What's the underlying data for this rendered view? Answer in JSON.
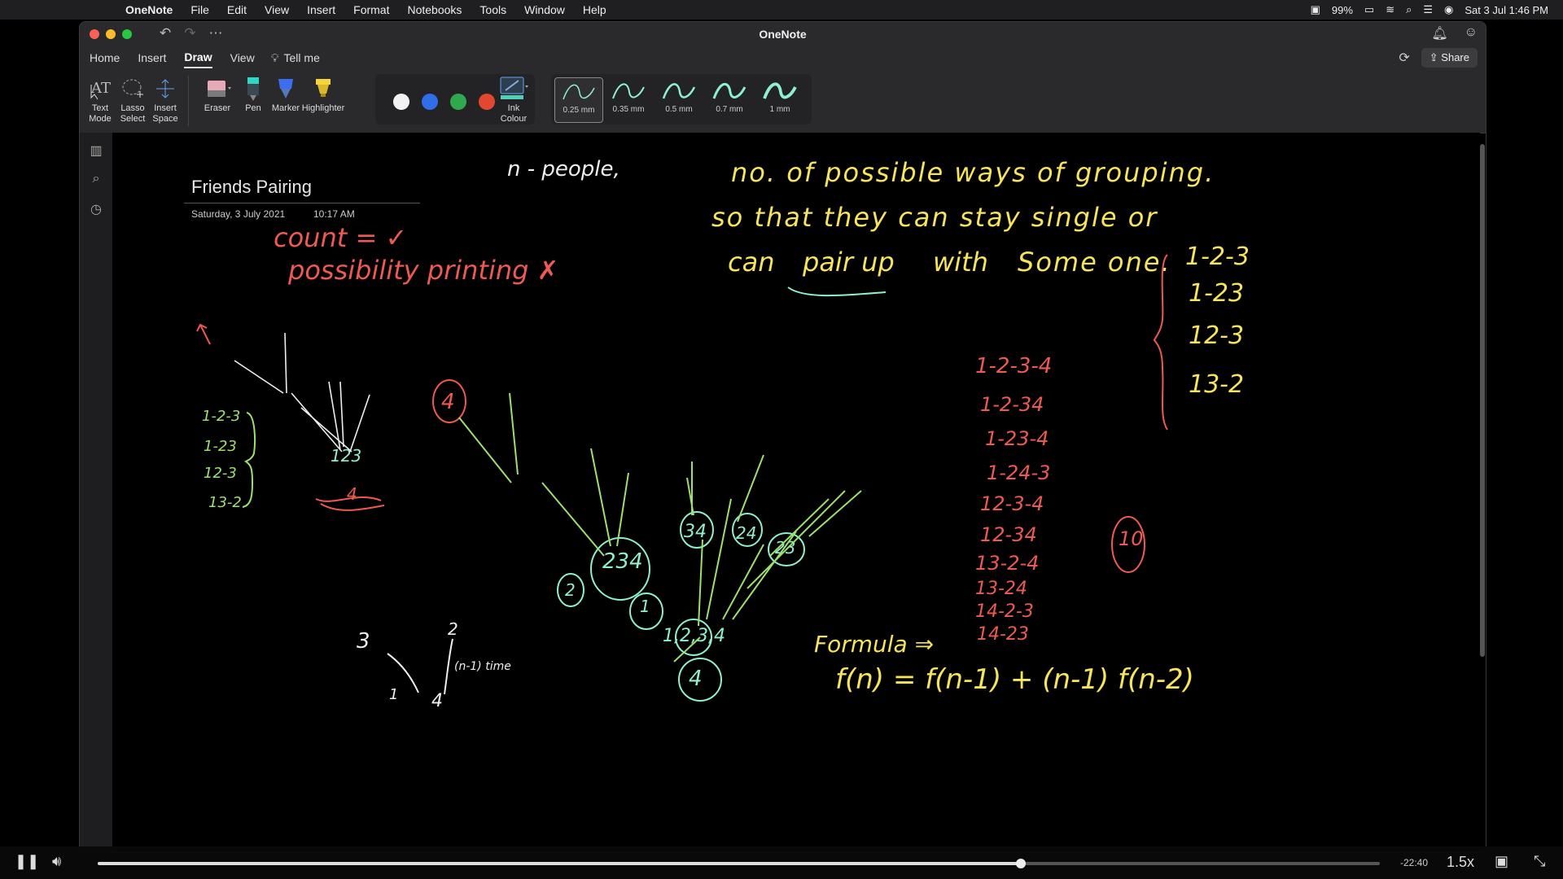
{
  "menubar": {
    "app": "OneNote",
    "items": [
      "File",
      "Edit",
      "View",
      "Insert",
      "Format",
      "Notebooks",
      "Tools",
      "Window",
      "Help"
    ],
    "battery": "99%",
    "datetime": "Sat 3 Jul  1:46 PM"
  },
  "window": {
    "title": "OneNote"
  },
  "ribbon": {
    "tabs": [
      "Home",
      "Insert",
      "Draw",
      "View"
    ],
    "active_tab": "Draw",
    "tell_me": "Tell me",
    "share": "Share"
  },
  "tools": {
    "text_mode": "Text\nMode",
    "lasso": "Lasso\nSelect",
    "insert_space": "Insert\nSpace",
    "eraser": "Eraser",
    "pen": "Pen",
    "marker": "Marker",
    "highlighter": "Highlighter",
    "ink_colour": "Ink\nColour"
  },
  "palette_colors": [
    "#f2f2f2",
    "#2f6ee8",
    "#2fa84f",
    "#e4472f"
  ],
  "thickness": {
    "options": [
      "0.25 mm",
      "0.35 mm",
      "0.5 mm",
      "0.7 mm",
      "1 mm"
    ],
    "selected": "0.25 mm"
  },
  "page": {
    "title": "Friends Pairing",
    "date": "Saturday, 3 July 2021",
    "time": "10:17 AM"
  },
  "ink": {
    "n_people": "n - people,",
    "problem_1": "no. of possible ways of grouping.",
    "problem_2": "so that they can stay single or",
    "problem_3a": "can",
    "problem_3b": "pair up",
    "problem_3c": "with",
    "problem_3d": "Some one.",
    "count": "count = ✓",
    "possibility": "possibility printing ✗",
    "list3": [
      "1-2-3",
      "1-23",
      "12-3",
      "13-2"
    ],
    "list4": [
      "1-2-3-4",
      "1-2-34",
      "1-23-4",
      "1-24-3",
      "12-3-4",
      "12-34",
      "13-2-4",
      "13-24",
      "14-2-3",
      "14-23"
    ],
    "total": "10",
    "formula_label": "Formula ⇒",
    "formula": "f(n) = f(n-1) + (n-1) f(n-2)",
    "small_list": [
      "1-2-3",
      "1-23",
      "12-3",
      "13-2"
    ],
    "tree_root": "1,2,3,4",
    "node_4": "4",
    "node_234": "234",
    "node_1": "1",
    "node_2": "2",
    "node_34": "34",
    "node_24": "24",
    "node_23": "23",
    "node_123": "123",
    "node_4small": "4",
    "tiny_a": "3",
    "tiny_b": "2",
    "tiny_c": "1",
    "tiny_d": "4",
    "tiny_e": "(n-1) time"
  },
  "player": {
    "time_remaining": "-22:40",
    "speed": "1.5x",
    "progress": 0.72
  }
}
